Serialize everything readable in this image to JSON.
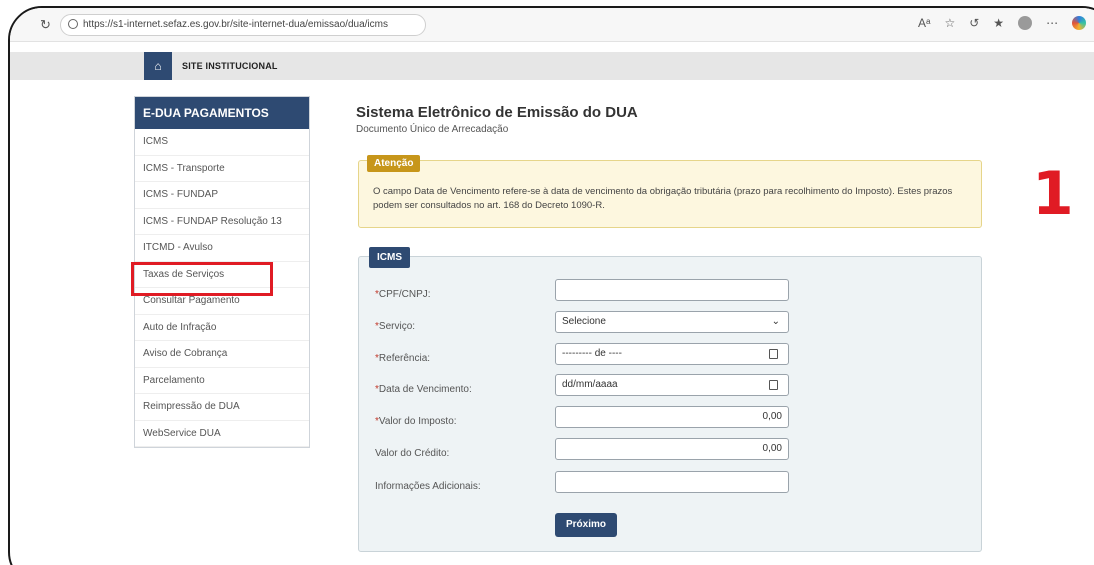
{
  "browser": {
    "url": "https://s1-internet.sefaz.es.gov.br/site-internet-dua/emissao/dua/icms",
    "reload_icon": "reload-icon",
    "icons": [
      "read-aloud-icon",
      "favorite-icon",
      "refresh-icon",
      "collections-icon",
      "profile-icon",
      "more-icon",
      "copilot-icon"
    ]
  },
  "topnav": {
    "home_icon": "home-icon",
    "site_link": "SITE INSTITUCIONAL"
  },
  "sidebar": {
    "title": "E-DUA PAGAMENTOS",
    "items": [
      "ICMS",
      "ICMS - Transporte",
      "ICMS - FUNDAP",
      "ICMS - FUNDAP Resolução 13",
      "ITCMD - Avulso",
      "Taxas de Serviços",
      "Consultar Pagamento",
      "Auto de Infração",
      "Aviso de Cobrança",
      "Parcelamento",
      "Reimpressão de DUA",
      "WebService DUA"
    ],
    "highlighted_item": "Taxas de Serviços",
    "highlight_color": "#e01b24"
  },
  "main": {
    "title": "Sistema Eletrônico de Emissão do DUA",
    "subtitle": "Documento Único de Arrecadação"
  },
  "alert": {
    "tag": "Atenção",
    "text": "O campo Data de Vencimento refere-se à data de vencimento da obrigação tributária (prazo para recolhimento do Imposto). Estes prazos podem ser consultados no art. 168 do Decreto 1090-R."
  },
  "annotation": {
    "step_number": "1",
    "color": "#e01b24"
  },
  "form": {
    "tag": "ICMS",
    "required_marker": "*",
    "fields": {
      "cpf": {
        "label": "CPF/CNPJ:",
        "value": ""
      },
      "servico": {
        "label": "Serviço:",
        "value": "Selecione"
      },
      "referencia": {
        "label": "Referência:",
        "value": "--------- de ----"
      },
      "vencimento": {
        "label": "Data de Vencimento:",
        "value": "dd/mm/aaaa"
      },
      "valor_imposto": {
        "label": "Valor do Imposto:",
        "value": "0,00"
      },
      "valor_credito": {
        "label": "Valor do Crédito:",
        "value": "0,00"
      },
      "info": {
        "label": "Informações Adicionais:",
        "value": ""
      }
    },
    "submit_label": "Próximo"
  },
  "colors": {
    "primary": "#2e4a72",
    "alert_tag": "#c7961a",
    "alert_bg": "#fdf7df",
    "panel_bg": "#eef3f5"
  }
}
